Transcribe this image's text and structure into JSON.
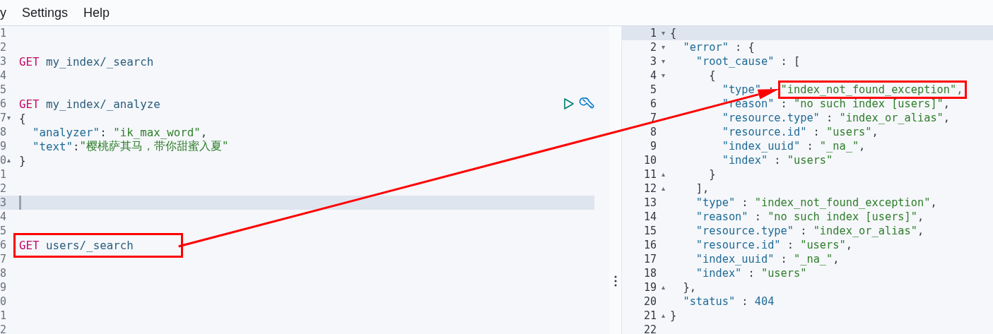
{
  "menu": [
    {
      "label": "y"
    },
    {
      "label": "Settings"
    },
    {
      "label": "Help"
    }
  ],
  "left_editor": {
    "lines": [
      {
        "number": "1",
        "active": false
      },
      {
        "number": "2",
        "active": false
      },
      {
        "number": "3",
        "active": false,
        "tokens": [
          {
            "text": "GET",
            "kind": "method"
          },
          {
            "text": " my_index/_search",
            "kind": "path"
          }
        ]
      },
      {
        "number": "4",
        "active": false
      },
      {
        "number": "5",
        "active": false
      },
      {
        "number": "6",
        "active": false,
        "tokens": [
          {
            "text": "GET",
            "kind": "method"
          },
          {
            "text": " my_index/_analyze",
            "kind": "path"
          }
        ],
        "actions": [
          {
            "kind": "run"
          },
          {
            "kind": "settings"
          }
        ]
      },
      {
        "number": "7",
        "active": false,
        "fold": "▾",
        "tokens": [
          {
            "text": "{",
            "kind": "punct"
          }
        ]
      },
      {
        "number": "8",
        "active": false,
        "tokens": [
          {
            "text": "  \"analyzer\"",
            "kind": "key"
          },
          {
            "text": ": ",
            "kind": "punct"
          },
          {
            "text": "\"ik_max_word\"",
            "kind": "string"
          },
          {
            "text": ",",
            "kind": "punct"
          }
        ]
      },
      {
        "number": "9",
        "active": false,
        "tokens": [
          {
            "text": "  \"text\"",
            "kind": "key"
          },
          {
            "text": ":",
            "kind": "punct"
          },
          {
            "text": "\"樱桃萨其马，带你甜蜜入夏\"",
            "kind": "string"
          }
        ]
      },
      {
        "number": "0",
        "active": false,
        "fold": "▴",
        "tokens": [
          {
            "text": "}",
            "kind": "punct"
          }
        ]
      },
      {
        "number": "1",
        "active": false
      },
      {
        "number": "2",
        "active": false
      },
      {
        "number": "3",
        "active": true
      },
      {
        "number": "4",
        "active": false
      },
      {
        "number": "5",
        "active": false
      },
      {
        "number": "6",
        "active": false,
        "boxed": true,
        "tokens": [
          {
            "text": "GET",
            "kind": "method"
          },
          {
            "text": " users/_search",
            "kind": "path"
          }
        ]
      },
      {
        "number": "7",
        "active": false
      },
      {
        "number": "8",
        "active": false
      },
      {
        "number": "9",
        "active": false
      },
      {
        "number": "0",
        "active": false
      },
      {
        "number": "1",
        "active": false
      },
      {
        "number": "2",
        "active": false
      }
    ]
  },
  "right_editor": {
    "lines": [
      {
        "number": "1",
        "active": true,
        "fold": "▾",
        "tokens": [
          {
            "text": "{",
            "kind": "punct"
          }
        ]
      },
      {
        "number": "2",
        "active": false,
        "fold": "▾",
        "tokens": [
          {
            "text": "  \"error\"",
            "kind": "key"
          },
          {
            "text": " : {",
            "kind": "punct"
          }
        ]
      },
      {
        "number": "3",
        "active": false,
        "fold": "▾",
        "tokens": [
          {
            "text": "    \"root_cause\"",
            "kind": "key"
          },
          {
            "text": " : [",
            "kind": "punct"
          }
        ]
      },
      {
        "number": "4",
        "active": false,
        "fold": "▾",
        "tokens": [
          {
            "text": "      {",
            "kind": "punct"
          }
        ]
      },
      {
        "number": "5",
        "active": false,
        "tokens": [
          {
            "text": "        \"type\"",
            "kind": "key"
          },
          {
            "text": " : ",
            "kind": "punct"
          },
          {
            "text": "\"index_not_found_exception\",",
            "kind": "string",
            "boxed": true
          }
        ]
      },
      {
        "number": "6",
        "active": false,
        "tokens": [
          {
            "text": "        \"reason\"",
            "kind": "key"
          },
          {
            "text": " : ",
            "kind": "punct"
          },
          {
            "text": "\"no such index [users]\"",
            "kind": "string"
          },
          {
            "text": ",",
            "kind": "punct"
          }
        ]
      },
      {
        "number": "7",
        "active": false,
        "tokens": [
          {
            "text": "        \"resource.type\"",
            "kind": "key"
          },
          {
            "text": " : ",
            "kind": "punct"
          },
          {
            "text": "\"index_or_alias\"",
            "kind": "string"
          },
          {
            "text": ",",
            "kind": "punct"
          }
        ]
      },
      {
        "number": "8",
        "active": false,
        "tokens": [
          {
            "text": "        \"resource.id\"",
            "kind": "key"
          },
          {
            "text": " : ",
            "kind": "punct"
          },
          {
            "text": "\"users\"",
            "kind": "string"
          },
          {
            "text": ",",
            "kind": "punct"
          }
        ]
      },
      {
        "number": "9",
        "active": false,
        "tokens": [
          {
            "text": "        \"index_uuid\"",
            "kind": "key"
          },
          {
            "text": " : ",
            "kind": "punct"
          },
          {
            "text": "\"_na_\"",
            "kind": "string"
          },
          {
            "text": ",",
            "kind": "punct"
          }
        ]
      },
      {
        "number": "10",
        "active": false,
        "tokens": [
          {
            "text": "        \"index\"",
            "kind": "key"
          },
          {
            "text": " : ",
            "kind": "punct"
          },
          {
            "text": "\"users\"",
            "kind": "string"
          }
        ]
      },
      {
        "number": "11",
        "active": false,
        "fold": "▴",
        "tokens": [
          {
            "text": "      }",
            "kind": "punct"
          }
        ]
      },
      {
        "number": "12",
        "active": false,
        "fold": "▴",
        "tokens": [
          {
            "text": "    ],",
            "kind": "punct"
          }
        ]
      },
      {
        "number": "13",
        "active": false,
        "tokens": [
          {
            "text": "    \"type\"",
            "kind": "key"
          },
          {
            "text": " : ",
            "kind": "punct"
          },
          {
            "text": "\"index_not_found_exception\"",
            "kind": "string"
          },
          {
            "text": ",",
            "kind": "punct"
          }
        ]
      },
      {
        "number": "14",
        "active": false,
        "tokens": [
          {
            "text": "    \"reason\"",
            "kind": "key"
          },
          {
            "text": " : ",
            "kind": "punct"
          },
          {
            "text": "\"no such index [users]\"",
            "kind": "string"
          },
          {
            "text": ",",
            "kind": "punct"
          }
        ]
      },
      {
        "number": "15",
        "active": false,
        "tokens": [
          {
            "text": "    \"resource.type\"",
            "kind": "key"
          },
          {
            "text": " : ",
            "kind": "punct"
          },
          {
            "text": "\"index_or_alias\"",
            "kind": "string"
          },
          {
            "text": ",",
            "kind": "punct"
          }
        ]
      },
      {
        "number": "16",
        "active": false,
        "tokens": [
          {
            "text": "    \"resource.id\"",
            "kind": "key"
          },
          {
            "text": " : ",
            "kind": "punct"
          },
          {
            "text": "\"users\"",
            "kind": "string"
          },
          {
            "text": ",",
            "kind": "punct"
          }
        ]
      },
      {
        "number": "17",
        "active": false,
        "tokens": [
          {
            "text": "    \"index_uuid\"",
            "kind": "key"
          },
          {
            "text": " : ",
            "kind": "punct"
          },
          {
            "text": "\"_na_\"",
            "kind": "string"
          },
          {
            "text": ",",
            "kind": "punct"
          }
        ]
      },
      {
        "number": "18",
        "active": false,
        "tokens": [
          {
            "text": "    \"index\"",
            "kind": "key"
          },
          {
            "text": " : ",
            "kind": "punct"
          },
          {
            "text": "\"users\"",
            "kind": "string"
          }
        ]
      },
      {
        "number": "19",
        "active": false,
        "fold": "▴",
        "tokens": [
          {
            "text": "  },",
            "kind": "punct"
          }
        ]
      },
      {
        "number": "20",
        "active": false,
        "tokens": [
          {
            "text": "  \"status\"",
            "kind": "key"
          },
          {
            "text": " : ",
            "kind": "punct"
          },
          {
            "text": "404",
            "kind": "number"
          }
        ]
      },
      {
        "number": "21",
        "active": false,
        "fold": "▴",
        "tokens": [
          {
            "text": "}",
            "kind": "punct"
          }
        ]
      },
      {
        "number": "22",
        "active": false
      }
    ]
  }
}
